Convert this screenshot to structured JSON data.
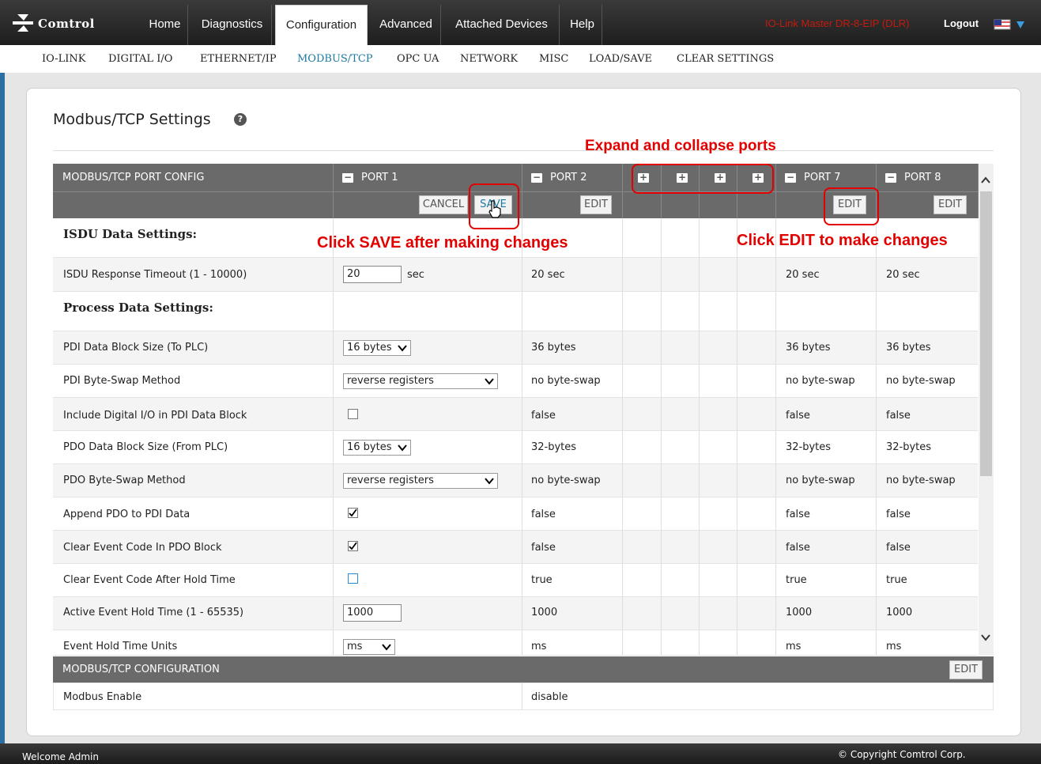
{
  "header": {
    "logo_text": "Comtrol",
    "tabs": [
      "Home",
      "Diagnostics",
      "Configuration",
      "Advanced",
      "Attached Devices",
      "Help"
    ],
    "active_tab": "Configuration",
    "device_name": "IO-Link Master DR-8-EIP (DLR)",
    "logout": "Logout"
  },
  "subnav": {
    "items": [
      "IO-LINK",
      "DIGITAL I/O",
      "ETHERNET/IP",
      "MODBUS/TCP",
      "OPC UA",
      "NETWORK",
      "MISC",
      "LOAD/SAVE",
      "CLEAR SETTINGS"
    ],
    "active": "MODBUS/TCP"
  },
  "page_title": "Modbus/TCP Settings",
  "annotations": {
    "expand": "Expand and collapse ports",
    "save": "Click SAVE after making changes",
    "edit": "Click EDIT to make changes"
  },
  "table": {
    "header_label": "MODBUS/TCP PORT CONFIG",
    "ports": [
      "PORT 1",
      "PORT 2",
      "PORT 7",
      "PORT 8"
    ],
    "buttons": {
      "cancel": "CANCEL",
      "save": "SAVE",
      "edit": "EDIT"
    },
    "sections": {
      "isdu": "ISDU Data Settings:",
      "process": "Process Data Settings:"
    },
    "rows": [
      {
        "label": "ISDU Response Timeout (1 - 10000)",
        "p1": "20",
        "p1_unit": "sec",
        "p2": "20 sec",
        "p7": "20 sec",
        "p8": "20 sec"
      },
      {
        "label": "PDI Data Block Size (To PLC)",
        "p1": "16 bytes",
        "p2": "36 bytes",
        "p7": "36 bytes",
        "p8": "36 bytes"
      },
      {
        "label": "PDI Byte-Swap Method",
        "p1": "reverse registers",
        "p2": "no byte-swap",
        "p7": "no byte-swap",
        "p8": "no byte-swap"
      },
      {
        "label": "Include Digital I/O in PDI Data Block",
        "p1_checked": false,
        "p2": "false",
        "p7": "false",
        "p8": "false"
      },
      {
        "label": "PDO Data Block Size (From PLC)",
        "p1": "16 bytes",
        "p2": "32-bytes",
        "p7": "32-bytes",
        "p8": "32-bytes"
      },
      {
        "label": "PDO Byte-Swap Method",
        "p1": "reverse registers",
        "p2": "no byte-swap",
        "p7": "no byte-swap",
        "p8": "no byte-swap"
      },
      {
        "label": "Append PDO to PDI Data",
        "p1_checked": true,
        "p2": "false",
        "p7": "false",
        "p8": "false"
      },
      {
        "label": "Clear Event Code In PDO Block",
        "p1_checked": true,
        "p2": "false",
        "p7": "false",
        "p8": "false"
      },
      {
        "label": "Clear Event Code After Hold Time",
        "p1_checked": false,
        "p2": "true",
        "p7": "true",
        "p8": "true"
      },
      {
        "label": "Active Event Hold Time (1 - 65535)",
        "p1": "1000",
        "p2": "1000",
        "p7": "1000",
        "p8": "1000"
      },
      {
        "label": "Event Hold Time Units",
        "p1": "ms",
        "p2": "ms",
        "p7": "ms",
        "p8": "ms"
      }
    ]
  },
  "config": {
    "header": "MODBUS/TCP CONFIGURATION",
    "edit": "EDIT",
    "row_label": "Modbus Enable",
    "row_value": "disable"
  },
  "footer": {
    "welcome": "Welcome Admin",
    "copyright": "© Copyright Comtrol Corp."
  },
  "colors": {
    "accent": "#1a7aa0",
    "annotation": "#e30000",
    "header_bg": "#6a6a6a"
  }
}
